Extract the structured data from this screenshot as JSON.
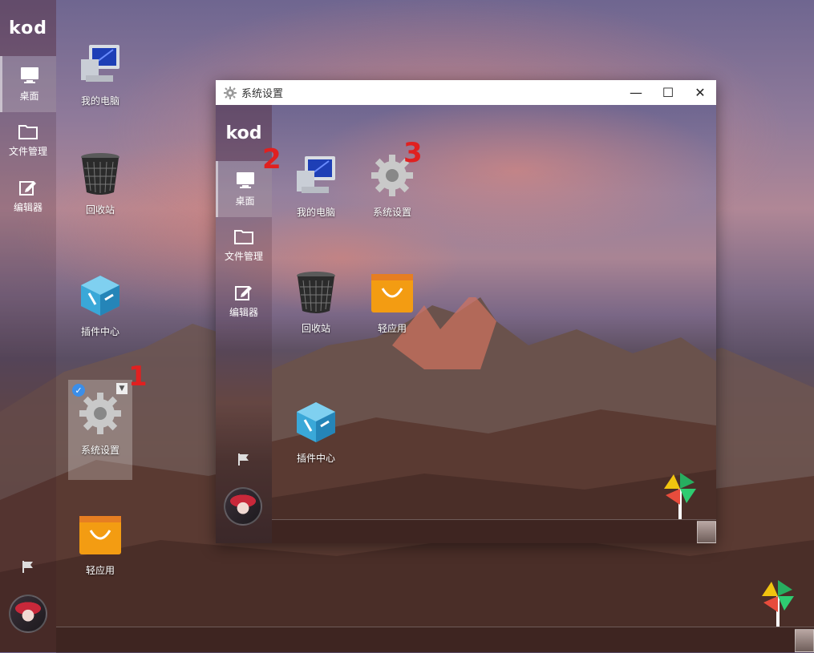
{
  "sidebar": {
    "logo": "kod",
    "items": [
      {
        "label": "桌面",
        "icon": "monitor-icon",
        "active": true
      },
      {
        "label": "文件管理",
        "icon": "folder-icon",
        "active": false
      },
      {
        "label": "编辑器",
        "icon": "edit-icon",
        "active": false
      }
    ]
  },
  "desktop": {
    "icons": [
      {
        "label": "我的电脑",
        "icon": "computer-icon"
      },
      {
        "label": "回收站",
        "icon": "recycle-bin-icon"
      },
      {
        "label": "插件中心",
        "icon": "plugin-center-icon"
      },
      {
        "label": "系统设置",
        "icon": "gear-icon",
        "selected": true
      },
      {
        "label": "轻应用",
        "icon": "shopping-bag-icon"
      }
    ]
  },
  "markers": {
    "one": "1",
    "two": "2",
    "three": "3"
  },
  "window": {
    "title": "系统设置",
    "controls": {
      "minimize": "—",
      "maximize": "☐",
      "close": "✕"
    },
    "sidebar": {
      "logo": "kod",
      "items": [
        {
          "label": "桌面",
          "icon": "monitor-icon",
          "active": true
        },
        {
          "label": "文件管理",
          "icon": "folder-icon",
          "active": false
        },
        {
          "label": "编辑器",
          "icon": "edit-icon",
          "active": false
        }
      ]
    },
    "icons": [
      {
        "label": "我的电脑",
        "icon": "computer-icon"
      },
      {
        "label": "系统设置",
        "icon": "gear-icon"
      },
      {
        "label": "回收站",
        "icon": "recycle-bin-icon"
      },
      {
        "label": "轻应用",
        "icon": "shopping-bag-icon"
      },
      {
        "label": "插件中心",
        "icon": "plugin-center-icon"
      }
    ]
  },
  "colors": {
    "marker": "#e02020",
    "accent": "#3b8ee8",
    "bag": "#f39c12"
  }
}
